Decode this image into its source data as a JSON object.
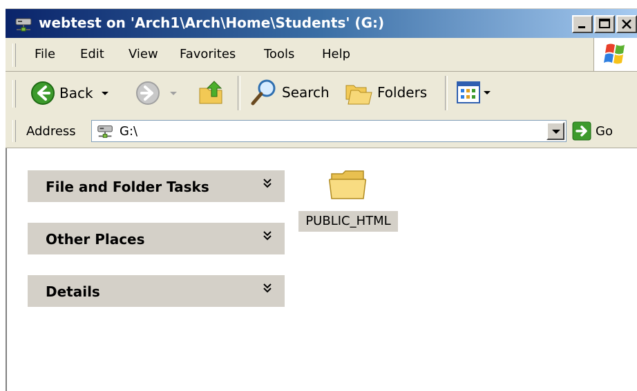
{
  "window": {
    "title": "webtest on 'Arch1\\Arch\\Home\\Students' (G:)"
  },
  "menu": {
    "file": "File",
    "edit": "Edit",
    "view": "View",
    "favorites": "Favorites",
    "tools": "Tools",
    "help": "Help"
  },
  "toolbar": {
    "back": "Back",
    "search": "Search",
    "folders": "Folders"
  },
  "address": {
    "label": "Address",
    "value": "G:\\",
    "go": "Go"
  },
  "task_panels": [
    {
      "title": "File and Folder Tasks"
    },
    {
      "title": "Other Places"
    },
    {
      "title": "Details"
    }
  ],
  "items": [
    {
      "name": "PUBLIC_HTML",
      "type": "folder"
    }
  ],
  "icons": {
    "title": "network-drive-icon",
    "back": "back-arrow-icon",
    "forward": "forward-arrow-icon",
    "up": "folder-up-icon",
    "search": "magnifier-icon",
    "folders": "folders-icon",
    "views": "views-icon",
    "go": "go-arrow-icon"
  },
  "colors": {
    "titlebar_start": "#0a246a",
    "titlebar_end": "#a6caf0",
    "chrome": "#ece9d8",
    "panel": "#d4d0c8",
    "nav_green": "#3c9a2c"
  }
}
